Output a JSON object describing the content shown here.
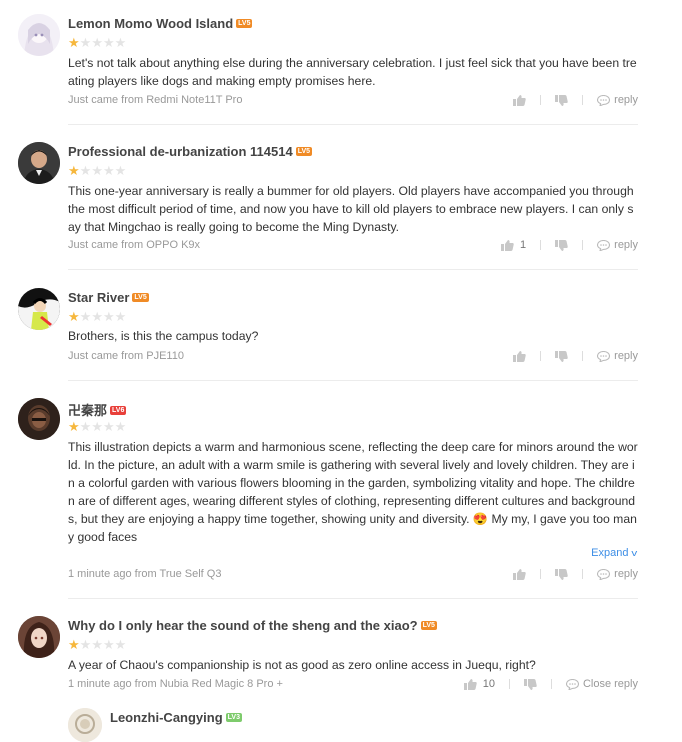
{
  "colors": {
    "star_on": "#f6b73c",
    "star_off": "#e4e4e4",
    "link": "#3d8ee6",
    "lv5": "#f08b26",
    "lv6": "#e8403a",
    "lv3": "#7ecb6c"
  },
  "comments": [
    {
      "name": "Lemon Momo Wood Island",
      "level": "LV5",
      "rating": 1,
      "text": "Let's not talk about anything else during the anniversary celebration. I just feel sick that you have been treating players like dogs and making empty promises here.",
      "meta": "Just came from Redmi Note11T Pro",
      "likes": "",
      "reply_label": "reply"
    },
    {
      "name": "Professional de-urbanization 114514",
      "level": "LV5",
      "rating": 1,
      "text": "This one-year anniversary is really a bummer for old players. Old players have accompanied you through the most difficult period of time, and now you have to kill old players to embrace new players. I can only say that Mingchao is really going to become the Ming Dynasty.",
      "meta": "Just came from OPPO K9x",
      "likes": "1",
      "reply_label": "reply"
    },
    {
      "name": "Star River",
      "level": "LV5",
      "rating": 1,
      "text": "Brothers, is this the campus today?",
      "meta": "Just came from PJE110",
      "likes": "",
      "reply_label": "reply"
    },
    {
      "name": "卍秦那",
      "level": "LV6",
      "rating": 1,
      "text": "This illustration depicts a warm and harmonious scene, reflecting the deep care for minors around the world. In the picture, an adult with a warm smile is gathering with several lively and lovely children. They are in a colorful garden with various flowers blooming in the garden, symbolizing vitality and hope. The children are of different ages, wearing different styles of clothing, representing different cultures and backgrounds, but they are enjoying a happy time together, showing unity and diversity. 😍 My my, I gave you too many good faces",
      "expand": "Expand",
      "meta": "1 minute ago from True Self Q3",
      "likes": "",
      "reply_label": "reply"
    },
    {
      "name": "Why do I only hear the sound of the sheng and the xiao?",
      "level": "LV5",
      "rating": 1,
      "text": "A year of Chaou's companionship is not as good as zero online access in Juequ, right?",
      "meta": "1 minute ago from Nubia Red Magic 8 Pro +",
      "likes": "10",
      "reply_label": "Close reply"
    }
  ],
  "sub_reply": {
    "name": "Leonzhi-Cangying",
    "level": "LV3"
  }
}
